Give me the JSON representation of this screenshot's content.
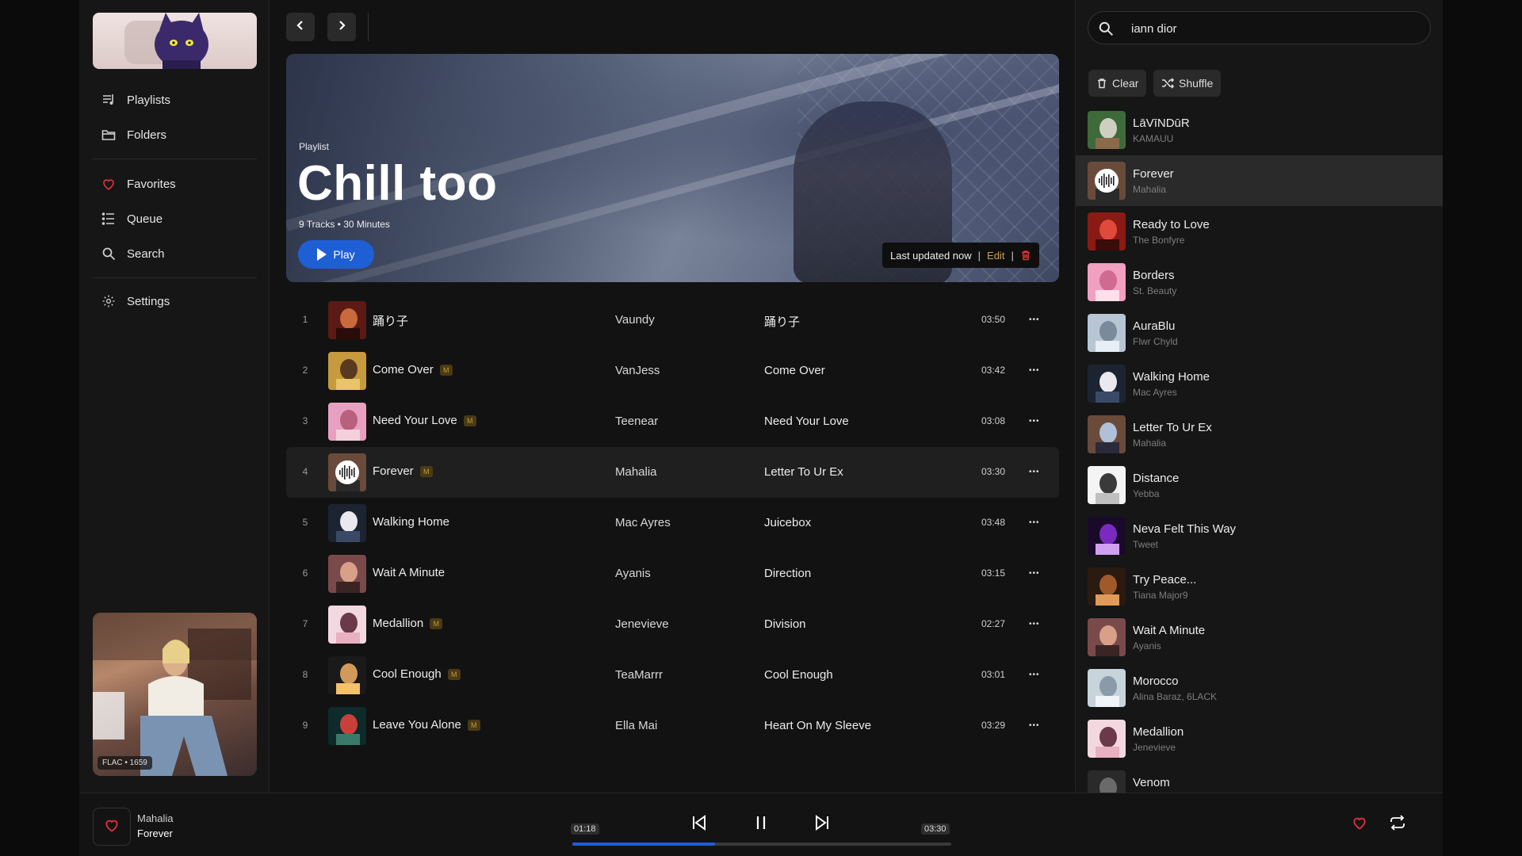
{
  "sidebar": {
    "items": [
      {
        "label": "Playlists",
        "icon": "playlist-icon"
      },
      {
        "label": "Folders",
        "icon": "folder-icon"
      },
      {
        "label": "Favorites",
        "icon": "heart-icon"
      },
      {
        "label": "Queue",
        "icon": "queue-icon"
      },
      {
        "label": "Search",
        "icon": "search-icon"
      },
      {
        "label": "Settings",
        "icon": "gear-icon"
      }
    ],
    "now_playing_badge": "FLAC • 1659"
  },
  "playlist": {
    "type_label": "Playlist",
    "title": "Chill too",
    "meta": "9 Tracks • 30 Minutes",
    "play_label": "Play",
    "updated_label": "Last updated now",
    "edit_label": "Edit",
    "tracks": [
      {
        "num": "1",
        "title": "踊り子",
        "artist": "Vaundy",
        "album": "踊り子",
        "duration": "03:50",
        "m": false
      },
      {
        "num": "2",
        "title": "Come Over",
        "artist": "VanJess",
        "album": "Come Over",
        "duration": "03:42",
        "m": true
      },
      {
        "num": "3",
        "title": "Need Your Love",
        "artist": "Teenear",
        "album": "Need Your Love",
        "duration": "03:08",
        "m": true
      },
      {
        "num": "4",
        "title": "Forever",
        "artist": "Mahalia",
        "album": "Letter To Ur Ex",
        "duration": "03:30",
        "m": true,
        "active": true
      },
      {
        "num": "5",
        "title": "Walking Home",
        "artist": "Mac Ayres",
        "album": "Juicebox",
        "duration": "03:48",
        "m": false
      },
      {
        "num": "6",
        "title": "Wait A Minute",
        "artist": "Ayanis",
        "album": "Direction",
        "duration": "03:15",
        "m": false
      },
      {
        "num": "7",
        "title": "Medallion",
        "artist": "Jenevieve",
        "album": "Division",
        "duration": "02:27",
        "m": true
      },
      {
        "num": "8",
        "title": "Cool Enough",
        "artist": "TeaMarrr",
        "album": "Cool Enough",
        "duration": "03:01",
        "m": true
      },
      {
        "num": "9",
        "title": "Leave You Alone",
        "artist": "Ella Mai",
        "album": "Heart On My Sleeve",
        "duration": "03:29",
        "m": true
      }
    ],
    "m_badge": "M"
  },
  "queue_panel": {
    "search_value": "iann dior",
    "clear_label": "Clear",
    "shuffle_label": "Shuffle",
    "items": [
      {
        "title": "LāVīNDūR",
        "artist": "KAMAUU"
      },
      {
        "title": "Forever",
        "artist": "Mahalia",
        "active": true
      },
      {
        "title": "Ready to Love",
        "artist": "The Bonfyre"
      },
      {
        "title": "Borders",
        "artist": "St. Beauty"
      },
      {
        "title": "AuraBlu",
        "artist": "Flwr Chyld"
      },
      {
        "title": "Walking Home",
        "artist": "Mac Ayres"
      },
      {
        "title": "Letter To Ur Ex",
        "artist": "Mahalia"
      },
      {
        "title": "Distance",
        "artist": "Yebba"
      },
      {
        "title": "Neva Felt This Way",
        "artist": "Tweet"
      },
      {
        "title": "Try Peace...",
        "artist": "Tiana Major9"
      },
      {
        "title": "Wait A Minute",
        "artist": "Ayanis"
      },
      {
        "title": "Morocco",
        "artist": "Alina Baraz, 6LACK"
      },
      {
        "title": "Medallion",
        "artist": "Jenevieve"
      },
      {
        "title": "Venom",
        "artist": ""
      }
    ]
  },
  "player": {
    "artist": "Mahalia",
    "title": "Forever",
    "elapsed": "01:18",
    "total": "03:30",
    "progress": 0.377
  },
  "colors": {
    "accent": "#1f5fd6",
    "heart": "#e0313b",
    "edit": "#c9a24a"
  }
}
